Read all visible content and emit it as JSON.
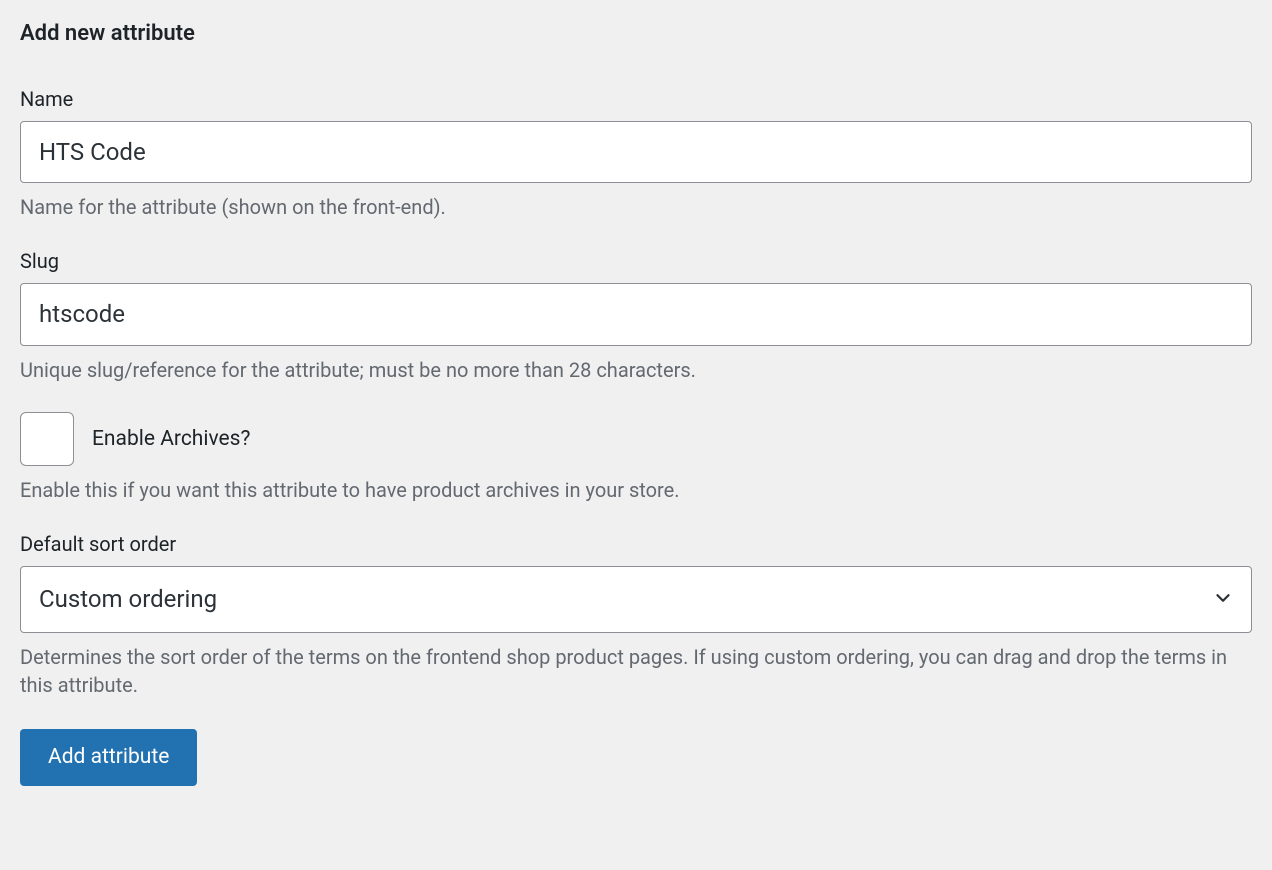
{
  "heading": "Add new attribute",
  "fields": {
    "name": {
      "label": "Name",
      "value": "HTS Code",
      "description": "Name for the attribute (shown on the front-end)."
    },
    "slug": {
      "label": "Slug",
      "value": "htscode",
      "description": "Unique slug/reference for the attribute; must be no more than 28 characters."
    },
    "enable_archives": {
      "label": "Enable Archives?",
      "checked": false,
      "description": "Enable this if you want this attribute to have product archives in your store."
    },
    "sort_order": {
      "label": "Default sort order",
      "selected": "Custom ordering",
      "description": "Determines the sort order of the terms on the frontend shop product pages. If using custom ordering, you can drag and drop the terms in this attribute."
    }
  },
  "submit_label": "Add attribute"
}
